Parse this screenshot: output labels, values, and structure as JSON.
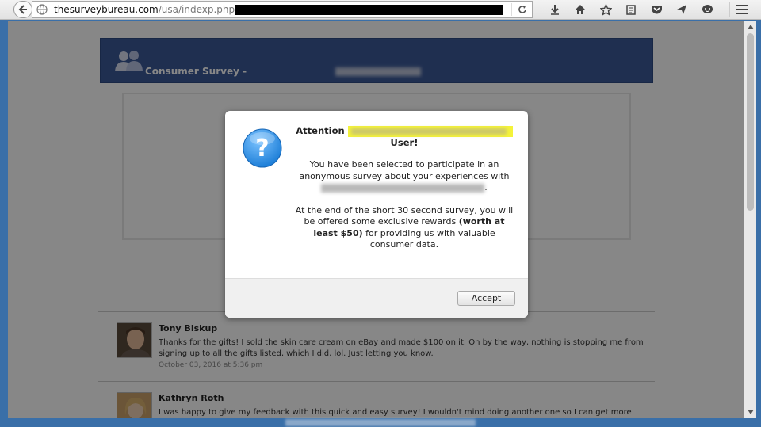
{
  "browser": {
    "url_domain": "thesurveybureau.com",
    "url_path": "/usa/indexp.php?",
    "icons": [
      "back-icon",
      "globe-icon",
      "reload-icon",
      "download-icon",
      "home-icon",
      "bookmark-star-icon",
      "reader-icon",
      "pocket-icon",
      "send-icon",
      "chat-icon",
      "menu-icon"
    ]
  },
  "page": {
    "header_title": "Consumer Survey -"
  },
  "dialog": {
    "title_prefix": "Attention",
    "title_suffix": "User!",
    "paragraph1": "You have been selected to participate in an anonymous survey about your experiences with",
    "paragraph2_start": "At the end of the short 30 second survey, you will be offered some exclusive rewards",
    "paragraph2_bold": "(worth at least $50)",
    "paragraph2_end": "for providing us with valuable consumer data.",
    "accept_label": "Accept"
  },
  "comments": [
    {
      "name": "Tony Biskup",
      "text": "Thanks for the gifts! I sold the skin care cream on eBay and made $100 on it. Oh by the way, nothing is stopping me from signing up to all the gifts listed, which I did, lol. Just letting you know.",
      "date": "October 03, 2016 at 5:36 pm"
    },
    {
      "name": "Kathryn Roth",
      "text": "I was happy to give my feedback with this quick and easy survey! I wouldn't mind doing another one so I can get more"
    }
  ],
  "colors": {
    "header_blue": "#3b5998",
    "highlight_yellow": "#f4f33a",
    "question_icon_blue": "#1e7fd8"
  }
}
